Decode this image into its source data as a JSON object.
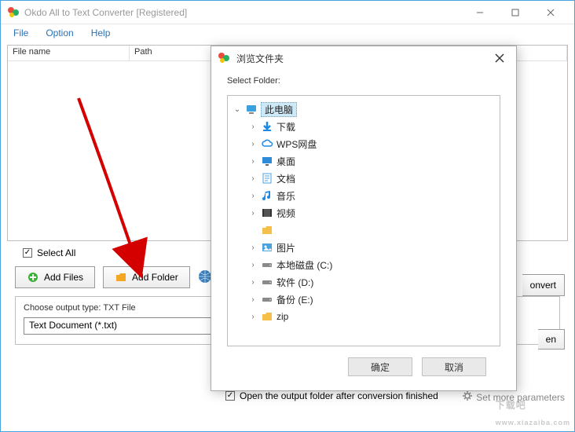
{
  "window": {
    "title": "Okdo All to Text Converter [Registered]"
  },
  "menubar": {
    "file": "File",
    "option": "Option",
    "help": "Help"
  },
  "filelist": {
    "col_filename": "File name",
    "col_path": "Path"
  },
  "select_all": {
    "label": "Select All",
    "checked": true
  },
  "buttons": {
    "add_files": "Add Files",
    "add_folder": "Add Folder",
    "convert_fragment": "onvert",
    "open_fragment": "en"
  },
  "output": {
    "label": "Choose output type:  TXT File",
    "select_value": "Text Document (*.txt)"
  },
  "bottom": {
    "open_folder_label": "Open the output folder after conversion finished",
    "open_folder_checked": true,
    "set_more": "Set more parameters"
  },
  "dialog": {
    "title": "浏览文件夹",
    "heading": "Select Folder:",
    "ok": "确定",
    "cancel": "取消",
    "tree": [
      {
        "depth": 0,
        "toggle": "open",
        "icon": "computer",
        "label": "此电脑",
        "selected": true
      },
      {
        "depth": 1,
        "toggle": "closed",
        "icon": "download",
        "label": "下载"
      },
      {
        "depth": 1,
        "toggle": "closed",
        "icon": "cloud",
        "label": "WPS网盘"
      },
      {
        "depth": 1,
        "toggle": "closed",
        "icon": "desktop",
        "label": "桌面"
      },
      {
        "depth": 1,
        "toggle": "closed",
        "icon": "document",
        "label": "文档"
      },
      {
        "depth": 1,
        "toggle": "closed",
        "icon": "music",
        "label": "音乐"
      },
      {
        "depth": 1,
        "toggle": "closed",
        "icon": "video",
        "label": "视频"
      },
      {
        "depth": 1,
        "toggle": "none",
        "icon": "folder",
        "label": ""
      },
      {
        "depth": 1,
        "toggle": "closed",
        "icon": "picture",
        "label": "图片"
      },
      {
        "depth": 1,
        "toggle": "closed",
        "icon": "drive",
        "label": "本地磁盘 (C:)"
      },
      {
        "depth": 1,
        "toggle": "closed",
        "icon": "drive",
        "label": "软件 (D:)"
      },
      {
        "depth": 1,
        "toggle": "closed",
        "icon": "drive",
        "label": "备份 (E:)"
      },
      {
        "depth": 1,
        "toggle": "closed",
        "icon": "folder",
        "label": "zip"
      }
    ]
  },
  "watermark": "下载吧",
  "watermark_url": "www.xiazaiba.com"
}
